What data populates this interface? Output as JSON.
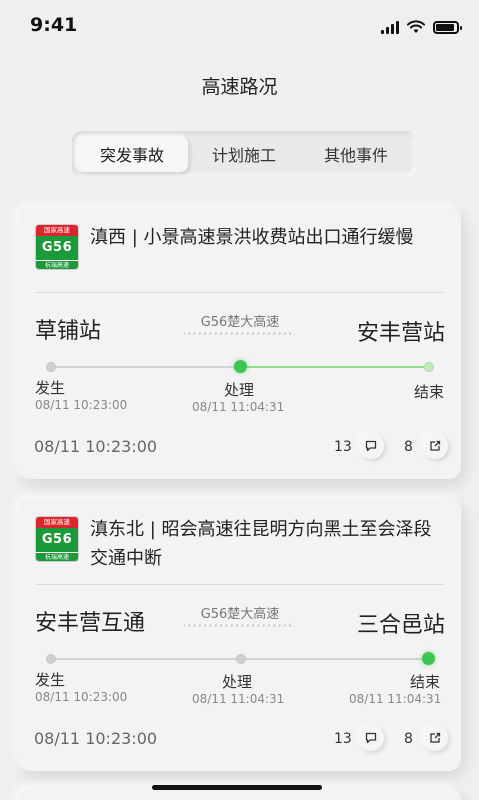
{
  "status_bar": {
    "time": "9:41"
  },
  "header": {
    "title": "高速路况"
  },
  "tabs": [
    {
      "label": "突发事故",
      "active": true
    },
    {
      "label": "计划施工",
      "active": false
    },
    {
      "label": "其他事件",
      "active": false
    }
  ],
  "cards": [
    {
      "badge": {
        "top": "国家高速",
        "code": "G56",
        "bottom": "杭瑞高速"
      },
      "title": "滇西 | 小景高速景洪收费站出口通行缓慢",
      "from_station": "草铺站",
      "to_station": "安丰营站",
      "highway": "G56楚大高速",
      "progress_step": 2,
      "steps": [
        {
          "label": "发生",
          "time": "08/11 10:23:00"
        },
        {
          "label": "处理",
          "time": "08/11 11:04:31"
        },
        {
          "label": "结束",
          "time": ""
        }
      ],
      "time": "08/11 10:23:00",
      "comments": "13",
      "shares": "8"
    },
    {
      "badge": {
        "top": "国家高速",
        "code": "G56",
        "bottom": "杭瑞高速"
      },
      "title": "滇东北 | 昭会高速往昆明方向黑土至会泽段交通中断",
      "from_station": "安丰营互通",
      "to_station": "三合邑站",
      "highway": "G56楚大高速",
      "progress_step": 3,
      "steps": [
        {
          "label": "发生",
          "time": "08/11 10:23:00"
        },
        {
          "label": "处理",
          "time": "08/11 11:04:31"
        },
        {
          "label": "结束",
          "time": "08/11 11:04:31"
        }
      ],
      "time": "08/11 10:23:00",
      "comments": "13",
      "shares": "8"
    }
  ],
  "colors": {
    "accent_green": "#3cc552",
    "badge_red": "#d8262c",
    "badge_green": "#1c9a3a"
  },
  "icons": [
    "signal-icon",
    "wifi-icon",
    "battery-icon",
    "comment-icon",
    "share-icon"
  ]
}
